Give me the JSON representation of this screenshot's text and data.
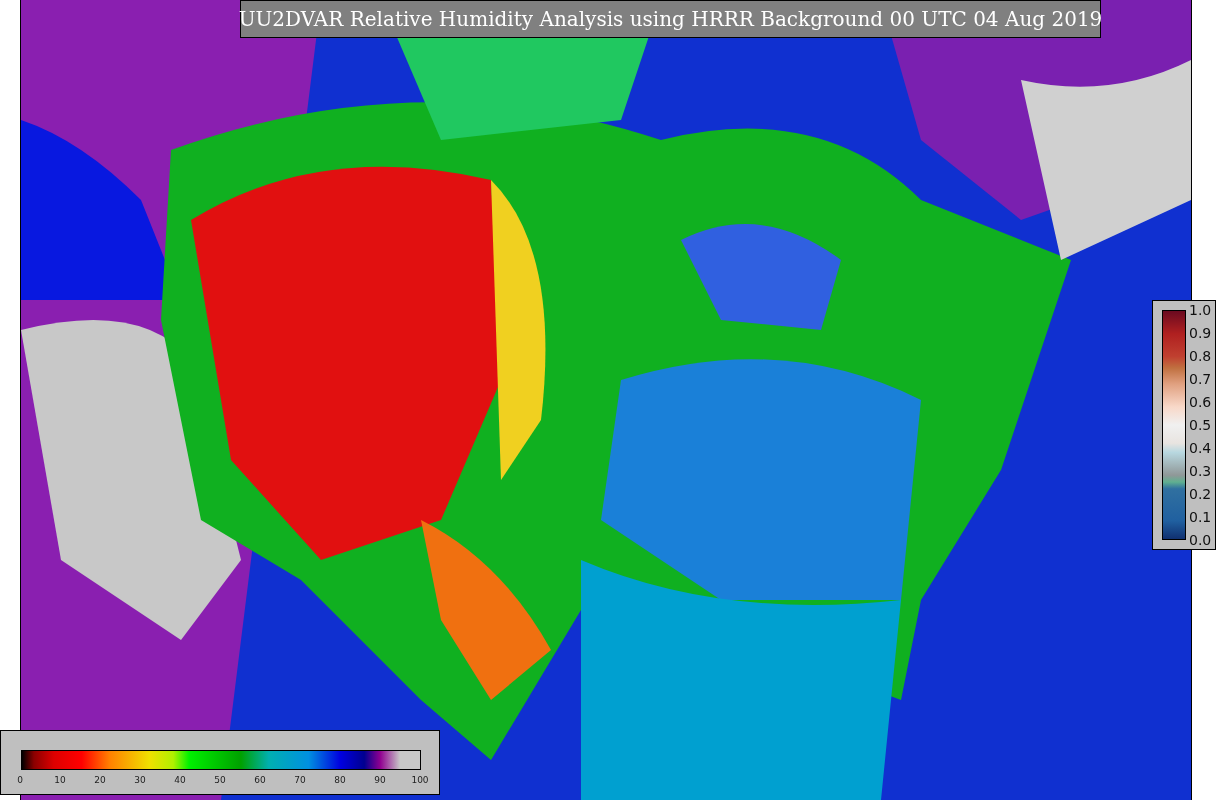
{
  "title": "UU2DVAR Relative Humidity Analysis using HRRR Background 00 UTC 04 Aug 2019",
  "humidity_colorbar": {
    "ticks": [
      "0",
      "10",
      "20",
      "30",
      "40",
      "50",
      "60",
      "70",
      "80",
      "90",
      "100"
    ]
  },
  "weight_colorbar": {
    "ticks": [
      "1.0",
      "0.9",
      "0.8",
      "0.7",
      "0.6",
      "0.5",
      "0.4",
      "0.3",
      "0.2",
      "0.1",
      "0.0"
    ]
  }
}
